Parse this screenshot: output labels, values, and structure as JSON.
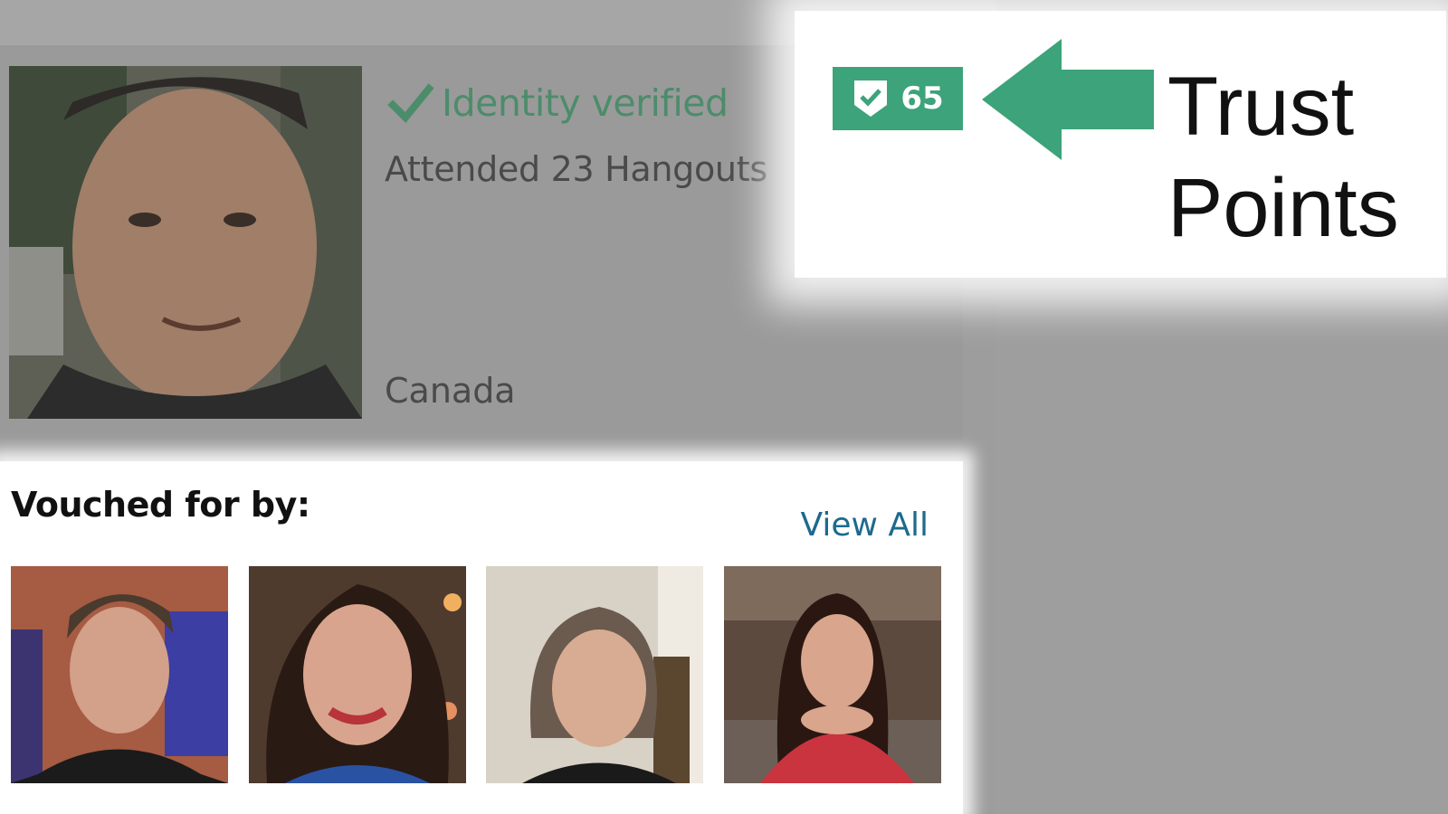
{
  "profile": {
    "verified_label": "Identity verified",
    "attended_label": "Attended 23 Hangouts",
    "location": "Canada",
    "photo_icon": "person-photo"
  },
  "trust": {
    "points": "65",
    "callout_line1": "Trust",
    "callout_line2": "Points",
    "badge_color": "#3ca37a",
    "arrow_color": "#3ca37a"
  },
  "vouched": {
    "title": "Vouched for by:",
    "view_all": "View All",
    "vouchers": [
      {
        "icon": "person-photo"
      },
      {
        "icon": "person-photo"
      },
      {
        "icon": "person-photo"
      },
      {
        "icon": "person-photo"
      }
    ]
  },
  "colors": {
    "verified_green": "#4c8c6b",
    "link_blue": "#1c6a8e"
  }
}
